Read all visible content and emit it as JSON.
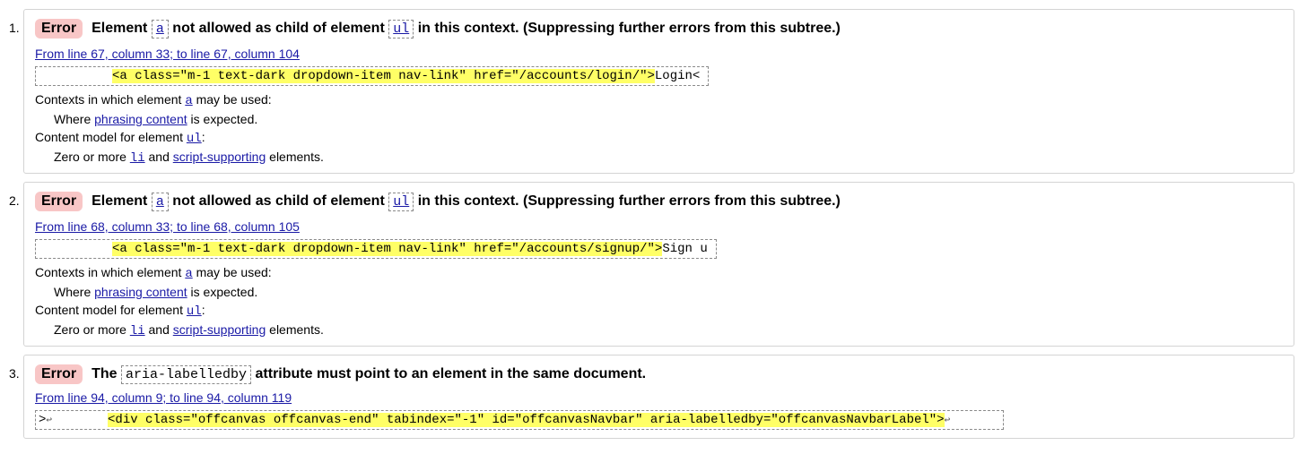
{
  "results": [
    {
      "number": "1.",
      "badge": "Error",
      "msg_pre": "Element",
      "code1": "a",
      "msg_mid": "not allowed as child of element",
      "code2": "ul",
      "msg_post": "in this context. (Suppressing further errors from this subtree.)",
      "location": "From line 67, column 33; to line 67, column 104",
      "extract_hl": "<a class=\"m-1 text-dark dropdown-item nav-link\" href=\"/accounts/login/\">",
      "extract_post": "Login<",
      "ctx_label": "Contexts in which element",
      "ctx_code": "a",
      "ctx_label_end": "may be used:",
      "ctx_where": "Where",
      "ctx_link": "phrasing content",
      "ctx_expected": "is expected.",
      "cm_label": "Content model for element",
      "cm_code": "ul",
      "cm_colon": ":",
      "cm_zero": "Zero or more",
      "cm_li": "li",
      "cm_and": "and",
      "cm_link": "script-supporting",
      "cm_elements": "elements."
    },
    {
      "number": "2.",
      "badge": "Error",
      "msg_pre": "Element",
      "code1": "a",
      "msg_mid": "not allowed as child of element",
      "code2": "ul",
      "msg_post": "in this context. (Suppressing further errors from this subtree.)",
      "location": "From line 68, column 33; to line 68, column 105",
      "extract_hl": "<a class=\"m-1 text-dark dropdown-item nav-link\" href=\"/accounts/signup/\">",
      "extract_post": "Sign u",
      "ctx_label": "Contexts in which element",
      "ctx_code": "a",
      "ctx_label_end": "may be used:",
      "ctx_where": "Where",
      "ctx_link": "phrasing content",
      "ctx_expected": "is expected.",
      "cm_label": "Content model for element",
      "cm_code": "ul",
      "cm_colon": ":",
      "cm_zero": "Zero or more",
      "cm_li": "li",
      "cm_and": "and",
      "cm_link": "script-supporting",
      "cm_elements": "elements."
    },
    {
      "number": "3.",
      "badge": "Error",
      "msg_pre": "The",
      "code1": "aria-labelledby",
      "msg_post": "attribute must point to an element in the same document.",
      "location": "From line 94, column 9; to line 94, column 119",
      "extract_pre": ">",
      "extract_hl": "<div class=\"offcanvas offcanvas-end\" tabindex=\"-1\" id=\"offcanvasNavbar\" aria-labelledby=\"offcanvasNavbarLabel\">",
      "return_glyph": "↩"
    }
  ]
}
